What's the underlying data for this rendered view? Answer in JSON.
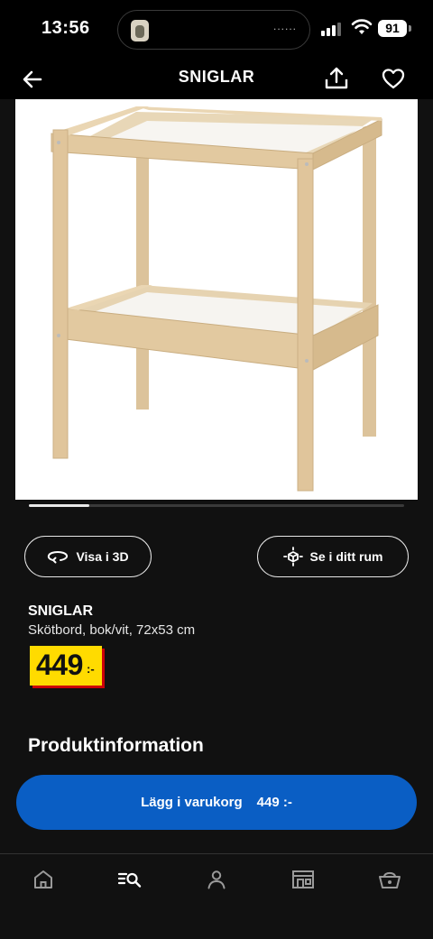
{
  "status_bar": {
    "time": "13:56",
    "island_dots": "......",
    "battery": "91"
  },
  "header": {
    "title": "SNIGLAR"
  },
  "actions": {
    "view_3d": "Visa i 3D",
    "view_room": "Se i ditt rum"
  },
  "product": {
    "name": "SNIGLAR",
    "description": "Skötbord, bok/vit, 72x53 cm",
    "price": "449",
    "price_suffix": ":-"
  },
  "sections": {
    "product_info": "Produktinformation"
  },
  "cart": {
    "label": "Lägg i varukorg",
    "price": "449 :-"
  },
  "carousel": {
    "progress": 0.16
  },
  "colors": {
    "accent_blue": "#0a5ec4",
    "price_yellow": "#ffdb00",
    "price_shadow": "#cc0008",
    "background": "#111111"
  },
  "bottom_nav": [
    {
      "icon": "home-icon",
      "active": false
    },
    {
      "icon": "search-list-icon",
      "active": true
    },
    {
      "icon": "profile-icon",
      "active": false
    },
    {
      "icon": "store-icon",
      "active": false
    },
    {
      "icon": "basket-icon",
      "active": false
    }
  ]
}
